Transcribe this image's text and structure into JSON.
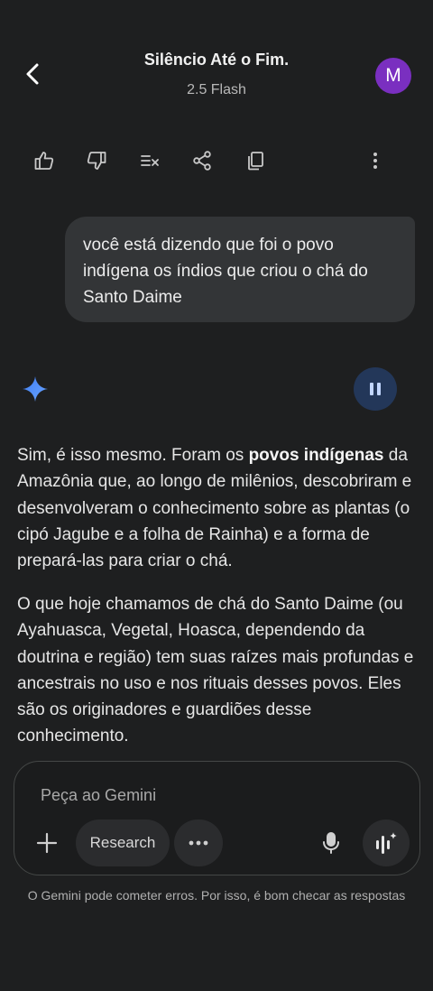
{
  "header": {
    "title": "Silêncio Até o Fim.",
    "model": "2.5 Flash",
    "avatar_letter": "M"
  },
  "actions": [
    "thumbs-up",
    "thumbs-down",
    "modify-response",
    "share",
    "copy",
    "more-options"
  ],
  "user_message": "você está dizendo que foi o povo indígena os índios que criou o chá do Santo Daime",
  "response": {
    "p1_start": "Sim, é isso mesmo. Foram os ",
    "p1_bold": "povos indígenas",
    "p1_end": " da Amazônia que, ao longo de milênios, descobriram e desenvolveram o conhecimento sobre as plantas (o cipó Jagube e a folha de Rainha) e a forma de prepará-las para criar o chá.",
    "p2": "O que hoje chamamos de chá do Santo Daime (ou Ayahuasca, Vegetal, Hoasca, dependendo da doutrina e região) tem suas raízes mais profundas e ancestrais no uso e nos rituais desses povos. Eles são os originadores e guardiões desse conhecimento."
  },
  "composer": {
    "placeholder": "Peça ao Gemini",
    "research_label": "Research"
  },
  "disclaimer": "O Gemini pode cometer erros. Por isso, é bom checar as respostas",
  "colors": {
    "background": "#1e1f20",
    "bubble": "#333537",
    "avatar": "#7a2fc0",
    "pause_button": "#233759",
    "spark": "#4a8cff"
  }
}
